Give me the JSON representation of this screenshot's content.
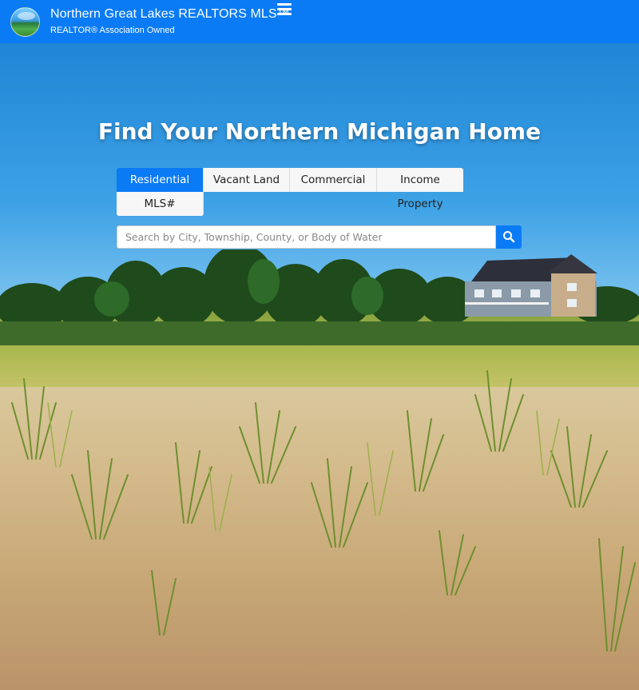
{
  "header": {
    "title": "Northern Great Lakes REALTORS MLS™",
    "subtitle": "REALTOR® Association Owned",
    "logo_icon": "globe-logo-icon",
    "menu_icon": "hamburger-menu-icon",
    "background_color": "#0a7bf5"
  },
  "hero": {
    "title": "Find Your Northern Michigan Home",
    "tabs": [
      {
        "label": "Residential",
        "active": true
      },
      {
        "label": "Vacant Land",
        "active": false
      },
      {
        "label": "Commercial",
        "active": false
      },
      {
        "label": "Income Property",
        "active": false
      },
      {
        "label": "MLS#",
        "active": false
      }
    ],
    "search": {
      "placeholder": "Search by City, Township, County, or Body of Water",
      "value": "",
      "button_icon": "search-icon"
    }
  },
  "colors": {
    "accent": "#0a7bf5",
    "tab_inactive": "#f7f7f7"
  }
}
